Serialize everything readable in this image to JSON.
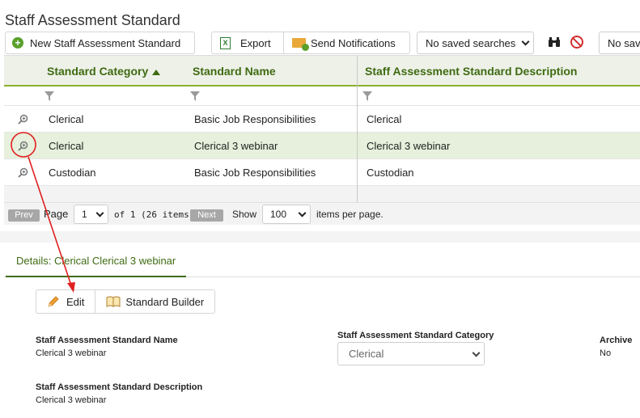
{
  "page": {
    "title": "Staff Assessment Standard"
  },
  "toolbar": {
    "new_label": "New Staff Assessment Standard",
    "export_label": "Export",
    "notify_label": "Send Notifications",
    "saved_search_1": "No saved searches",
    "saved_search_2": "No sav"
  },
  "grid": {
    "columns": [
      "Standard Category",
      "Standard Name",
      "Staff Assessment Standard Description"
    ],
    "rows": [
      {
        "category": "Clerical",
        "name": "Basic Job Responsibilities",
        "description": "Clerical"
      },
      {
        "category": "Clerical",
        "name": "Clerical 3 webinar",
        "description": "Clerical 3 webinar"
      },
      {
        "category": "Custodian",
        "name": "Basic Job Responsibilities",
        "description": "Custodian"
      }
    ],
    "selected_row": 1
  },
  "pager": {
    "prev": "Prev",
    "page_label": "Page",
    "page_value": "1",
    "of_text": "of 1 (26 items)",
    "next": "Next",
    "show_label": "Show",
    "per_page": "100",
    "per_page_text": "items per page."
  },
  "details": {
    "tab_label": "Details: Clerical Clerical 3 webinar",
    "edit_label": "Edit",
    "builder_label": "Standard Builder",
    "name_label": "Staff Assessment Standard Name",
    "name_value": "Clerical 3 webinar",
    "category_label": "Staff Assessment Standard Category",
    "category_value": "Clerical",
    "archive_label": "Archive",
    "archive_value": "No",
    "desc_label": "Staff Assessment Standard Description",
    "desc_value": "Clerical 3 webinar"
  },
  "colors": {
    "accent_green": "#3e6b12",
    "header_rule": "#8bb12e",
    "selected_row": "#e6f0dc",
    "annotation_red": "#e02020"
  }
}
